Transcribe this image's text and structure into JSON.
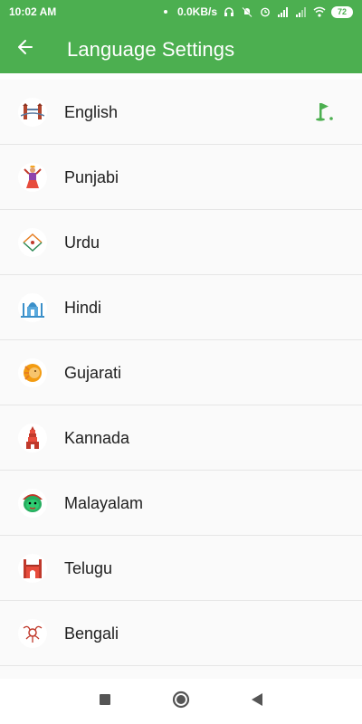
{
  "status_bar": {
    "time": "10:02 AM",
    "network_speed": "0.0KB/s",
    "battery": "72"
  },
  "header": {
    "back_icon": "arrow-left-icon",
    "title": "Language Settings"
  },
  "languages": [
    {
      "label": "English",
      "icon": "tower-bridge-icon",
      "selected": true
    },
    {
      "label": "Punjabi",
      "icon": "bhangra-dancer-icon",
      "selected": false
    },
    {
      "label": "Urdu",
      "icon": "crescent-icon",
      "selected": false
    },
    {
      "label": "Hindi",
      "icon": "taj-mahal-icon",
      "selected": false
    },
    {
      "label": "Gujarati",
      "icon": "lion-icon",
      "selected": false
    },
    {
      "label": "Kannada",
      "icon": "temple-tower-icon",
      "selected": false
    },
    {
      "label": "Malayalam",
      "icon": "kathakali-mask-icon",
      "selected": false
    },
    {
      "label": "Telugu",
      "icon": "charminar-icon",
      "selected": false
    },
    {
      "label": "Bengali",
      "icon": "alpona-art-icon",
      "selected": false
    }
  ],
  "selected_marker_icon": "golf-flag-icon",
  "colors": {
    "primary": "#4caf50",
    "list_bg": "#fafafa",
    "divider": "#e6e6e6",
    "text": "#212121"
  },
  "navigation_bar": {
    "items": [
      "recents-square-icon",
      "home-circle-icon",
      "back-triangle-icon"
    ]
  }
}
